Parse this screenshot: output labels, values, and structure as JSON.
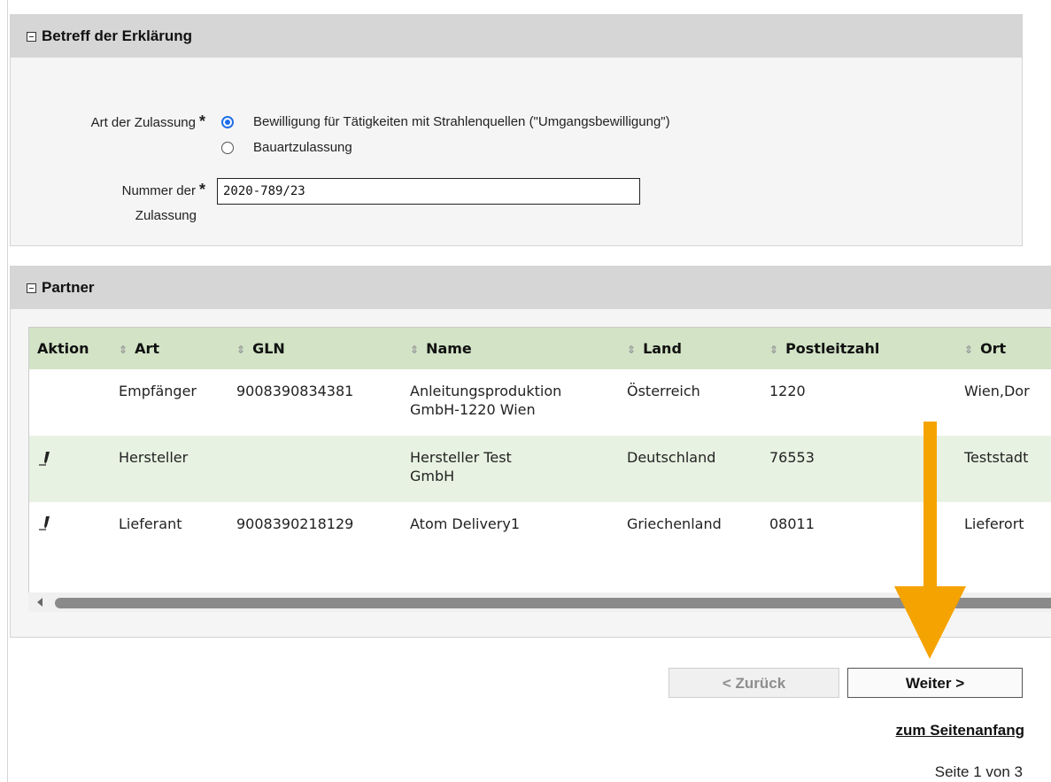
{
  "section1": {
    "title": "Betreff der Erklärung",
    "art_label": "Art der Zulassung",
    "required_mark": "*",
    "options": [
      {
        "label": "Bewilligung für Tätigkeiten mit Strahlenquellen (\"Umgangsbewilligung\")",
        "checked": true
      },
      {
        "label": "Bauartzulassung",
        "checked": false
      }
    ],
    "nummer_label_1": "Nummer der",
    "nummer_label_2": "Zulassung",
    "nummer_value": "2020-789/23"
  },
  "section2": {
    "title": "Partner",
    "columns": [
      "Aktion",
      "Art",
      "GLN",
      "Name",
      "Land",
      "Postleitzahl",
      "Ort"
    ],
    "rows": [
      {
        "aktion": "",
        "art": "Empfänger",
        "gln": "9008390834381",
        "name_1": "Anleitungsproduktion",
        "name_2": "GmbH-1220 Wien",
        "land": "Österreich",
        "plz": "1220",
        "ort": "Wien,Dor"
      },
      {
        "aktion": "edit",
        "art": "Hersteller",
        "gln": "",
        "name_1": "Hersteller Test",
        "name_2": "GmbH",
        "land": "Deutschland",
        "plz": "76553",
        "ort": "Teststadt"
      },
      {
        "aktion": "edit",
        "art": "Lieferant",
        "gln": "9008390218129",
        "name_1": "Atom Delivery1",
        "name_2": "",
        "land": "Griechenland",
        "plz": "08011",
        "ort": "Lieferort"
      }
    ]
  },
  "nav": {
    "back_label": "< Zurück",
    "next_label": "Weiter >",
    "top_link": "zum Seitenanfang",
    "page_info": "Seite 1 von 3"
  },
  "colors": {
    "header_bg": "#d6d6d6",
    "table_header_bg": "#d2e3c6",
    "alt_row_bg": "#e8f2e2",
    "arrow": "#f5a300",
    "radio_accent": "#1e6ee8"
  },
  "icons": [
    "collapse-icon",
    "sort-icon",
    "pencil-icon",
    "arrow-down-annotation"
  ]
}
